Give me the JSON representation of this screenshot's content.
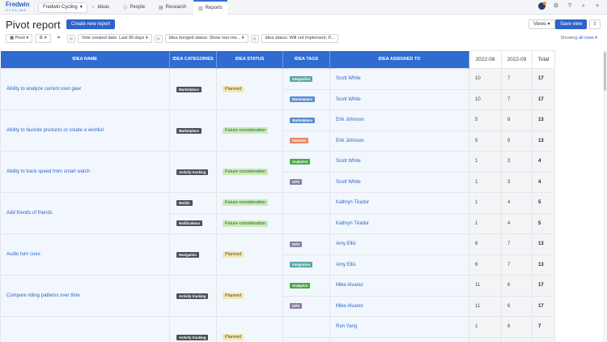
{
  "logo": {
    "line1": "Fredwin",
    "line2": "CYCLING"
  },
  "workspace": "Fredwin Cycling",
  "nav": {
    "ideas": "Ideas",
    "people": "People",
    "research": "Research",
    "reports": "Reports"
  },
  "header": {
    "title": "Pivot report",
    "create_button": "Create new report",
    "views_button": "Views",
    "save_button": "Save view"
  },
  "filters": {
    "pivot": "Pivot",
    "vote_created": "Vote created date: Last 90 days",
    "merged_status": "Idea merged status: Show non-me...",
    "idea_status": "Idea status: Will not implement, P..."
  },
  "showing": {
    "prefix": "Showing ",
    "link": "all rows"
  },
  "columns": {
    "name": "Idea name",
    "categories": "Idea categories",
    "status": "Idea status",
    "tags": "Idea tags",
    "assigned": "Idea assigned to",
    "p1": "2022-08",
    "p2": "2022-09",
    "total": "Total"
  },
  "rows": [
    {
      "name": "Ability to analyze current user gear",
      "categories": [
        "Marketplace"
      ],
      "status": "Planned",
      "sub": [
        {
          "tag": "Integration",
          "assignee": "Scott White",
          "p1": "10",
          "p2": "7",
          "total": "17"
        },
        {
          "tag": "Marketplace",
          "assignee": "Scott White",
          "p1": "10",
          "p2": "7",
          "total": "17"
        }
      ]
    },
    {
      "name": "Ability to favorite products or create a wishlist",
      "categories": [
        "Marketplace"
      ],
      "status": "Future consideration",
      "sub": [
        {
          "tag": "Marketplace",
          "assignee": "Erik Johnson",
          "p1": "5",
          "p2": "8",
          "total": "13"
        },
        {
          "tag": "Partners",
          "assignee": "Erik Johnson",
          "p1": "5",
          "p2": "8",
          "total": "13"
        }
      ]
    },
    {
      "name": "Ability to track speed from smart watch",
      "categories": [
        "Activity tracking"
      ],
      "status": "Future consideration",
      "sub": [
        {
          "tag": "Analytics",
          "assignee": "Scott White",
          "p1": "1",
          "p2": "3",
          "total": "4"
        },
        {
          "tag": "GPS",
          "assignee": "Scott White",
          "p1": "1",
          "p2": "3",
          "total": "4"
        }
      ]
    },
    {
      "name": "Add friends of friends",
      "categories": [
        "Mobile",
        "Notifications"
      ],
      "status": "Future consideration",
      "sub": [
        {
          "tag": "",
          "assignee": "Kathryn Tirador",
          "p1": "1",
          "p2": "4",
          "total": "5"
        },
        {
          "tag": "",
          "assignee": "Kathryn Tirador",
          "p1": "1",
          "p2": "4",
          "total": "5"
        }
      ]
    },
    {
      "name": "Audio turn cues",
      "categories": [
        "Navigation"
      ],
      "status": "Planned",
      "sub": [
        {
          "tag": "GPS",
          "assignee": "Amy Ellis",
          "p1": "6",
          "p2": "7",
          "total": "13"
        },
        {
          "tag": "Integration",
          "assignee": "Amy Ellis",
          "p1": "6",
          "p2": "7",
          "total": "13"
        }
      ]
    },
    {
      "name": "Compare riding patterns over time",
      "categories": [
        "Activity tracking"
      ],
      "status": "Planned",
      "sub": [
        {
          "tag": "Analytics",
          "assignee": "Mike Alvarez",
          "p1": "11",
          "p2": "6",
          "total": "17"
        },
        {
          "tag": "GPS",
          "assignee": "Mike Alvarez",
          "p1": "11",
          "p2": "6",
          "total": "17"
        }
      ]
    },
    {
      "name": "",
      "categories": [
        "Activity tracking"
      ],
      "status": "Planned",
      "sub": [
        {
          "tag": "",
          "assignee": "Ron Yang",
          "p1": "1",
          "p2": "6",
          "total": "7"
        },
        {
          "tag": "",
          "assignee": "",
          "p1": "",
          "p2": "",
          "total": ""
        }
      ]
    }
  ],
  "colors": {
    "accent": "#2f63c9",
    "header_bg": "#2f6bd0",
    "row_bg": "#f1f7fd",
    "tag_colors": {
      "Integration": "#5aa8a4",
      "Marketplace": "#5b8ed1",
      "Partners": "#e98668",
      "Analytics": "#4aa844",
      "GPS": "#8a7fa5"
    }
  }
}
